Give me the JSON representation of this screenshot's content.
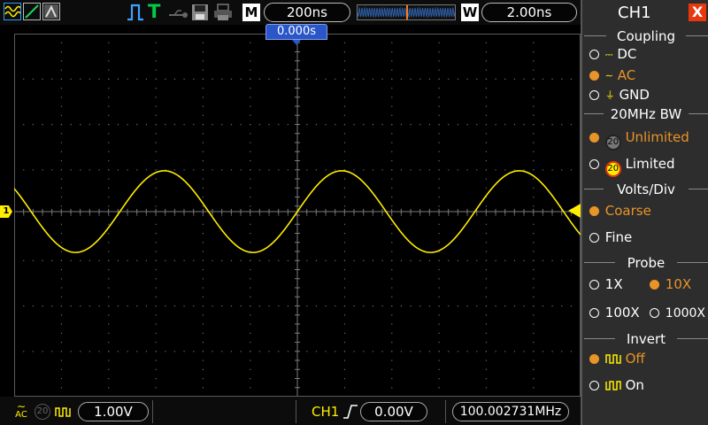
{
  "top_bar": {
    "timebase_label": "M",
    "timebase_value": "200ns",
    "trigger_state": "T",
    "window_label": "W",
    "window_value": "2.00ns"
  },
  "screen": {
    "trigger_time": "0.000s",
    "channel_marker": "1"
  },
  "bottom_bar": {
    "coupling_symbol": "AC",
    "bw_symbol": "20",
    "ch1_scale": "1.00V",
    "trigger_source": "CH1",
    "trigger_level": "0.00V",
    "frequency": "100.002731MHz"
  },
  "side_menu": {
    "title": "CH1",
    "close_label": "X",
    "sections": {
      "coupling": {
        "title": "Coupling",
        "options": [
          {
            "label": "DC",
            "selected": false
          },
          {
            "label": "AC",
            "selected": true
          },
          {
            "label": "GND",
            "selected": false
          }
        ]
      },
      "bandwidth": {
        "title": "20MHz BW",
        "options": [
          {
            "label": "Unlimited",
            "selected": true
          },
          {
            "label": "Limited",
            "selected": false
          }
        ]
      },
      "volts_div": {
        "title": "Volts/Div",
        "options": [
          {
            "label": "Coarse",
            "selected": true
          },
          {
            "label": "Fine",
            "selected": false
          }
        ]
      },
      "probe": {
        "title": "Probe",
        "options": [
          {
            "label": "1X",
            "selected": false
          },
          {
            "label": "10X",
            "selected": true
          },
          {
            "label": "100X",
            "selected": false
          },
          {
            "label": "1000X",
            "selected": false
          }
        ]
      },
      "invert": {
        "title": "Invert",
        "options": [
          {
            "label": "Off",
            "selected": true
          },
          {
            "label": "On",
            "selected": false
          }
        ]
      }
    }
  },
  "colors": {
    "trace": "#ffee00",
    "selected_option": "#e89428",
    "trigger_time_marker": "#2a56c8",
    "trigger_ready": "#00cc44",
    "run_status_icon": "#3fa0ff"
  },
  "waveform": {
    "type": "sine",
    "frequency_mhz": 100.002731,
    "cycles_on_screen": 3,
    "amplitude_div": 0.9
  }
}
